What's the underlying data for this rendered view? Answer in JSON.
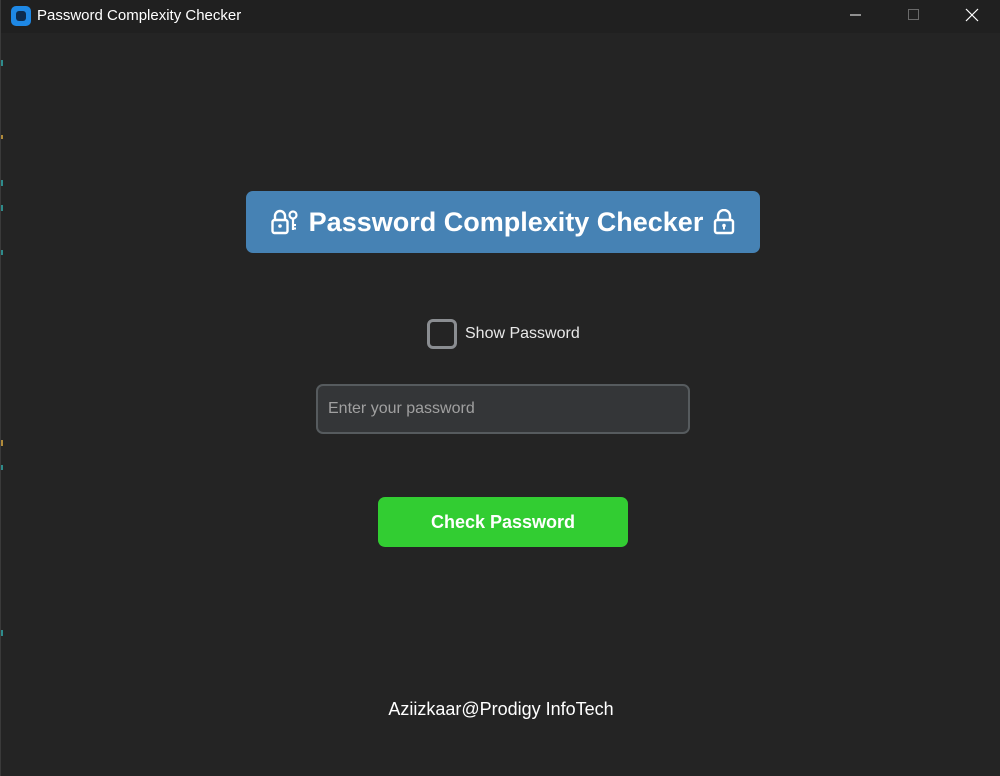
{
  "window": {
    "title": "Password Complexity Checker",
    "icon": "app-icon",
    "controls": [
      "minimize-icon",
      "maximize-icon",
      "close-icon"
    ]
  },
  "header": {
    "title": "Password Complexity Checker",
    "left_icon": "lock-with-key-icon",
    "right_icon": "lock-icon",
    "background": "#4682b4"
  },
  "show_password": {
    "label": "Show Password",
    "checked": false
  },
  "password_input": {
    "value": "",
    "placeholder": "Enter your password"
  },
  "check_button": {
    "label": "Check Password",
    "color": "#32cd32"
  },
  "footer": {
    "text": "Aziizkaar@Prodigy InfoTech"
  },
  "theme": {
    "background": "#242424",
    "titlebar": "#202020"
  }
}
